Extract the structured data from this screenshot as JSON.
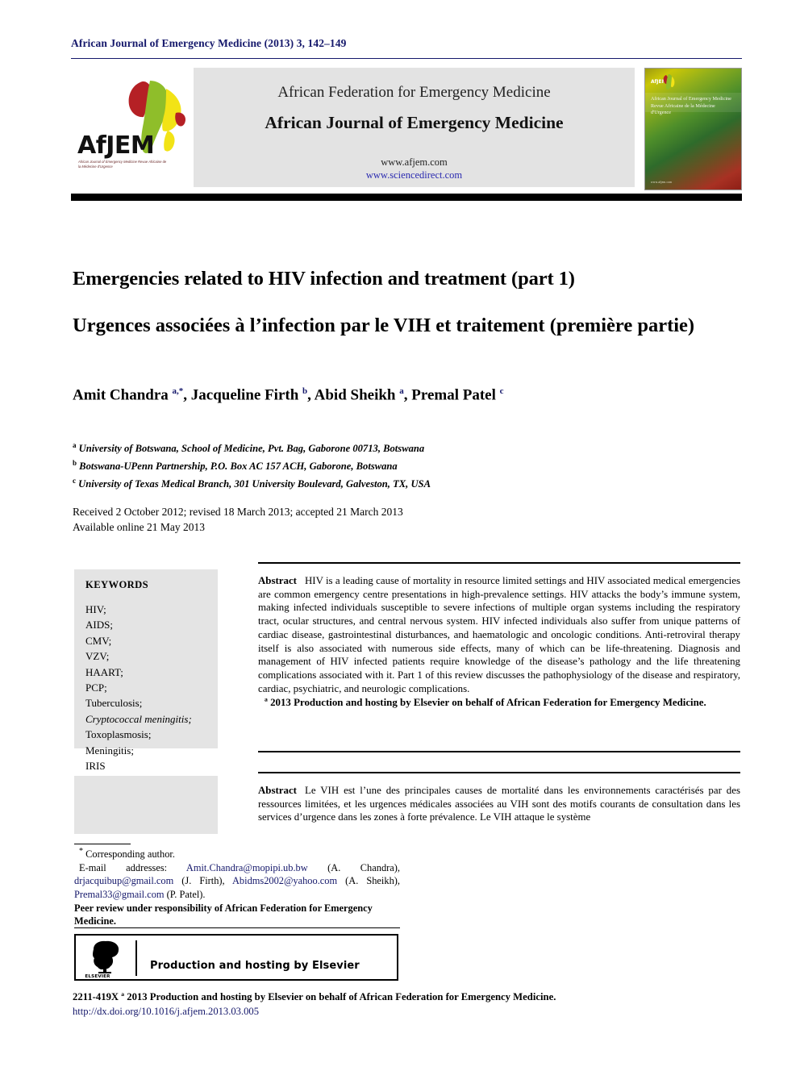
{
  "running_head": "African Journal of Emergency Medicine (2013) 3, 142–149",
  "masthead": {
    "logo_wordmark": "AfJEM",
    "logo_subtitle": "African Journal of Emergency Medicine Revue Africaine de la Médecine d'Urgence",
    "federation_line": "African Federation for Emergency Medicine",
    "journal_line": "African Journal of Emergency Medicine",
    "url_journal": "www.afjem.com",
    "url_sciencedirect": "www.sciencedirect.com",
    "cover": {
      "logo_text": "AfJEM",
      "title_en": "African Journal of Emergency Medicine",
      "title_fr": "Revue Africaine de la Médecine d'Urgence",
      "footer": "www.afjem.com"
    }
  },
  "article": {
    "title_en": "Emergencies related to HIV infection and treatment (part 1)",
    "title_fr": "Urgences associées à l’infection par le VIH et traitement (première partie)",
    "authors": [
      {
        "name": "Amit Chandra",
        "marks": "a,*"
      },
      {
        "name": "Jacqueline Firth",
        "marks": "b"
      },
      {
        "name": "Abid Sheikh",
        "marks": "a"
      },
      {
        "name": "Premal Patel",
        "marks": "c"
      }
    ],
    "affiliations": [
      {
        "mark": "a",
        "text": "University of Botswana, School of Medicine, Pvt. Bag, Gaborone 00713, Botswana"
      },
      {
        "mark": "b",
        "text": "Botswana-UPenn Partnership, P.O. Box AC 157 ACH, Gaborone, Botswana"
      },
      {
        "mark": "c",
        "text": "University of Texas Medical Branch, 301 University Boulevard, Galveston, TX, USA"
      }
    ],
    "dates_line1": "Received 2 October 2012; revised 18 March 2013; accepted 21 March 2013",
    "dates_line2": "Available online 21 May 2013"
  },
  "keywords": {
    "heading": "KEYWORDS",
    "items": [
      {
        "text": "HIV;",
        "italic": false
      },
      {
        "text": "AIDS;",
        "italic": false
      },
      {
        "text": "CMV;",
        "italic": false
      },
      {
        "text": "VZV;",
        "italic": false
      },
      {
        "text": "HAART;",
        "italic": false
      },
      {
        "text": "PCP;",
        "italic": false
      },
      {
        "text": "Tuberculosis;",
        "italic": false
      },
      {
        "text": "Cryptococcal meningitis;",
        "italic": true
      },
      {
        "text": "Toxoplasmosis;",
        "italic": false
      },
      {
        "text": "Meningitis;",
        "italic": false
      },
      {
        "text": "IRIS",
        "italic": false
      }
    ]
  },
  "abstract_en": {
    "label": "Abstract",
    "body": "HIV is a leading cause of mortality in resource limited settings and HIV associated medical emergencies are common emergency centre presentations in high-prevalence settings. HIV attacks the body’s immune system, making infected individuals susceptible to severe infections of multiple organ systems including the respiratory tract, ocular structures, and central nervous system. HIV infected individuals also suffer from unique patterns of cardiac disease, gastrointestinal disturbances, and haematologic and oncologic conditions. Anti-retroviral therapy itself is also associated with numerous side effects, many of which can be life-threatening. Diagnosis and management of HIV infected patients require knowledge of the disease’s pathology and the life threatening complications associated with it. Part 1 of this review discusses the pathophysiology of the disease and respiratory, cardiac, psychiatric, and neurologic complications.",
    "copyright": "ª 2013 Production and hosting by Elsevier on behalf of African Federation for Emergency Medicine."
  },
  "abstract_fr": {
    "label": "Abstract",
    "body": "Le VIH est l’une des principales causes de mortalité dans les environnements caractérisés par des ressources limitées, et les urgences médicales associées au VIH sont des motifs courants de consultation dans les services d’urgence dans les zones à forte prévalence. Le VIH attaque le système"
  },
  "footnotes": {
    "corresponding": "Corresponding author.",
    "corresponding_mark": "*",
    "email_label": "E-mail addresses:",
    "emails": [
      {
        "address": "Amit.Chandra@mopipi.ub.bw",
        "owner": "(A. Chandra),"
      },
      {
        "address": "drjacquibup@gmail.com",
        "owner": "(J. Firth),"
      },
      {
        "address": "Abidms2002@yahoo.com",
        "owner": "(A. Sheikh),"
      },
      {
        "address": "Premal33@gmail.com",
        "owner": "(P. Patel)."
      }
    ],
    "peer_review": "Peer review under responsibility of African Federation for Emergency Medicine."
  },
  "elsevier_box": {
    "label": "Production and hosting by Elsevier",
    "logo_word": "ELSEVIER"
  },
  "bottom": {
    "line1": "2211-419X ª 2013 Production and hosting by Elsevier on behalf of African Federation for Emergency Medicine.",
    "line2": "http://dx.doi.org/10.1016/j.afjem.2013.03.005"
  },
  "colors": {
    "link_blue": "#15186b",
    "band_grey": "#e3e3e3",
    "keyword_grey": "#e4e4e4",
    "map_red": "#b52025",
    "map_green": "#8fbe2a",
    "map_yellow": "#f2e316"
  }
}
